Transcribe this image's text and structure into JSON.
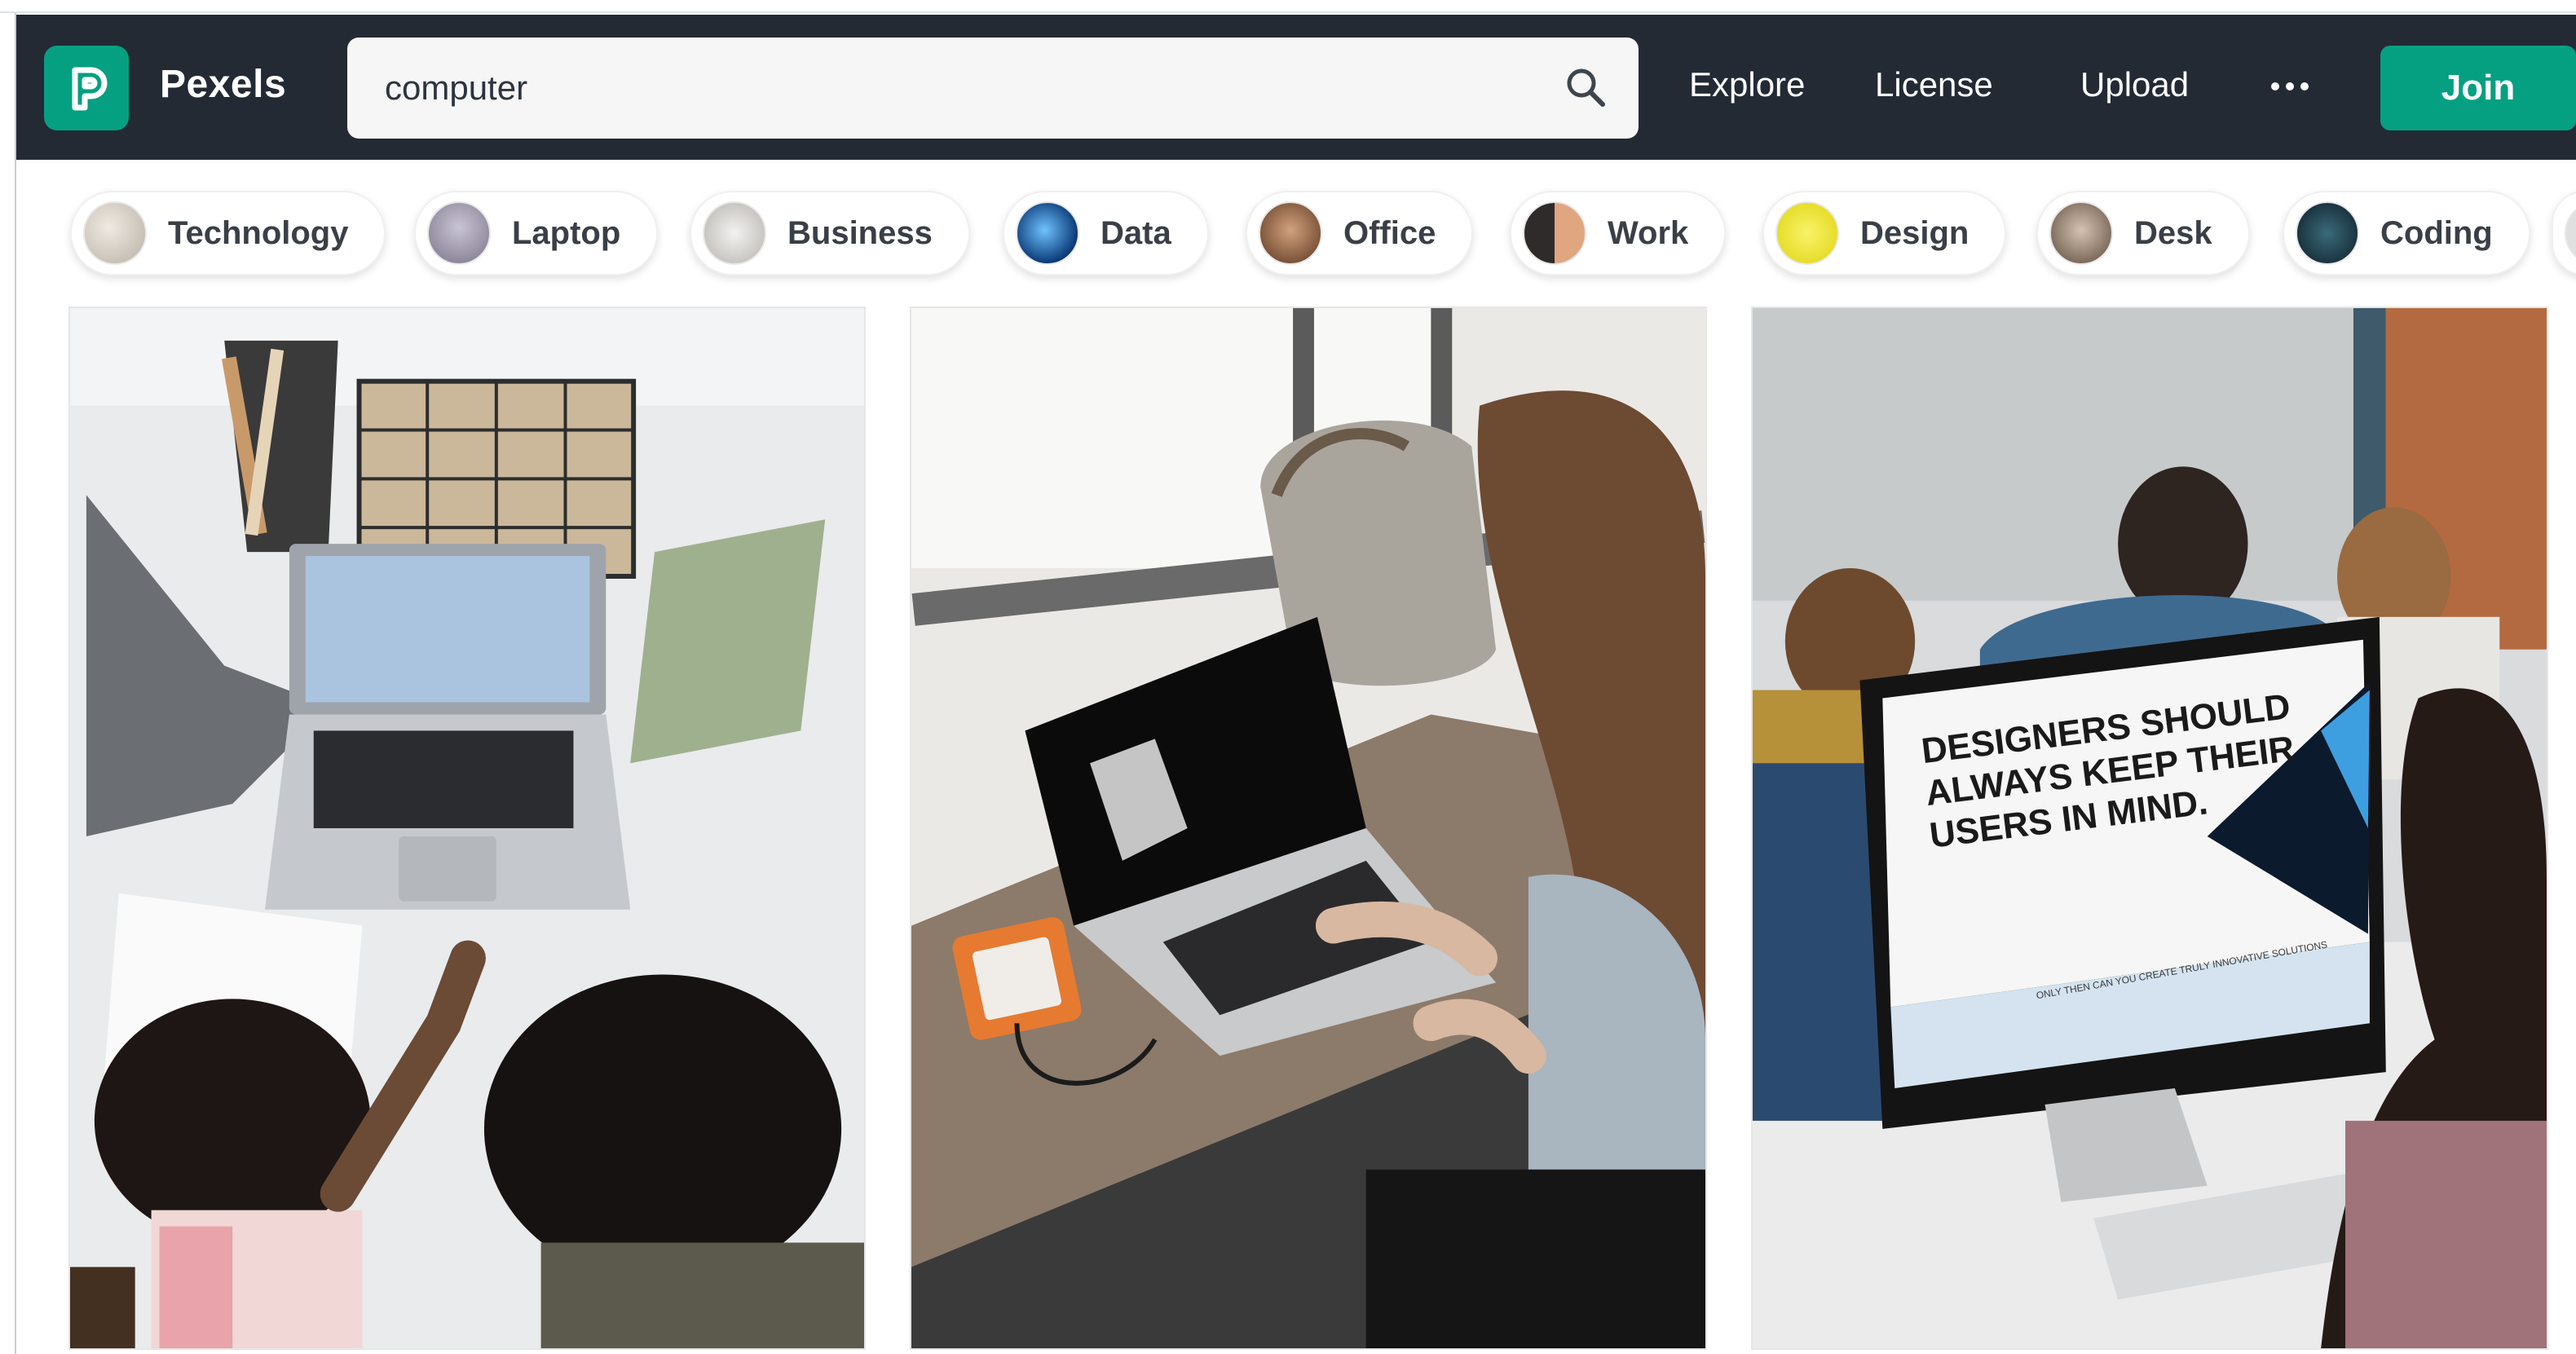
{
  "header": {
    "brand": "Pexels",
    "search_value": "computer",
    "nav": [
      "Explore",
      "License",
      "Upload"
    ],
    "join_label": "Join"
  },
  "chips": [
    {
      "label": "Technology",
      "thumb_color": "#c9c4bc"
    },
    {
      "label": "Laptop",
      "thumb_color": "#8f8a98"
    },
    {
      "label": "Business",
      "thumb_color": "#d8d6d3"
    },
    {
      "label": "Data",
      "thumb_color": "#1f6fb5"
    },
    {
      "label": "Office",
      "thumb_color": "#8a5a3c"
    },
    {
      "label": "Work",
      "thumb_color": "#6a4c38"
    },
    {
      "label": "Design",
      "thumb_color": "#e8e020"
    },
    {
      "label": "Desk",
      "thumb_color": "#6d5a4b"
    },
    {
      "label": "Coding",
      "thumb_color": "#203848"
    }
  ],
  "photos": [
    {
      "name": "Kids at laptop on white desk"
    },
    {
      "name": "Woman typing on laptop by window"
    },
    {
      "name": "Team at iMac in office"
    }
  ],
  "monitor_text": {
    "headline_1": "DESIGNERS SHOULD",
    "headline_2": "ALWAYS KEEP THEIR",
    "headline_3": "USERS IN MIND.",
    "footer": "ONLY THEN CAN YOU CREATE TRULY INNOVATIVE SOLUTIONS"
  },
  "colors": {
    "header_bg": "#232a34",
    "brand_green": "#05a081"
  }
}
